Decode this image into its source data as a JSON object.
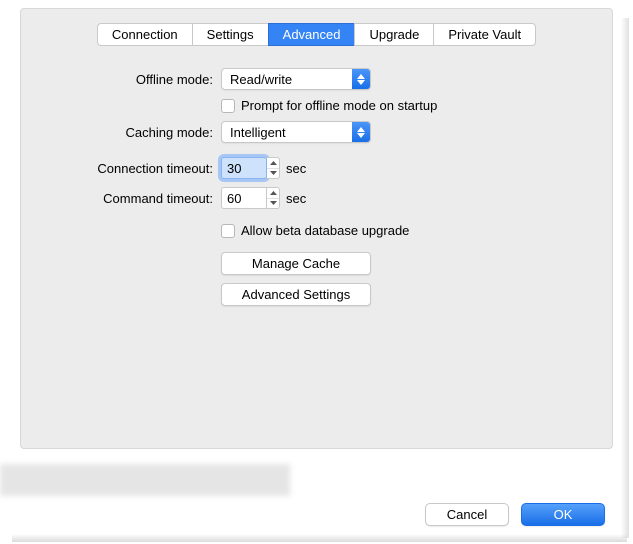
{
  "tabs": {
    "items": [
      {
        "label": "Connection"
      },
      {
        "label": "Settings"
      },
      {
        "label": "Advanced"
      },
      {
        "label": "Upgrade"
      },
      {
        "label": "Private Vault"
      }
    ],
    "active_index": 2
  },
  "form": {
    "offline_mode": {
      "label": "Offline mode:",
      "value": "Read/write"
    },
    "prompt_offline": {
      "label": "Prompt for offline mode on startup",
      "checked": false
    },
    "caching_mode": {
      "label": "Caching mode:",
      "value": "Intelligent"
    },
    "connection_timeout": {
      "label": "Connection timeout:",
      "value": "30",
      "unit": "sec"
    },
    "command_timeout": {
      "label": "Command timeout:",
      "value": "60",
      "unit": "sec"
    },
    "allow_beta": {
      "label": "Allow beta database upgrade",
      "checked": false
    },
    "manage_cache_label": "Manage Cache",
    "advanced_settings_label": "Advanced Settings"
  },
  "footer": {
    "cancel_label": "Cancel",
    "ok_label": "OK"
  }
}
